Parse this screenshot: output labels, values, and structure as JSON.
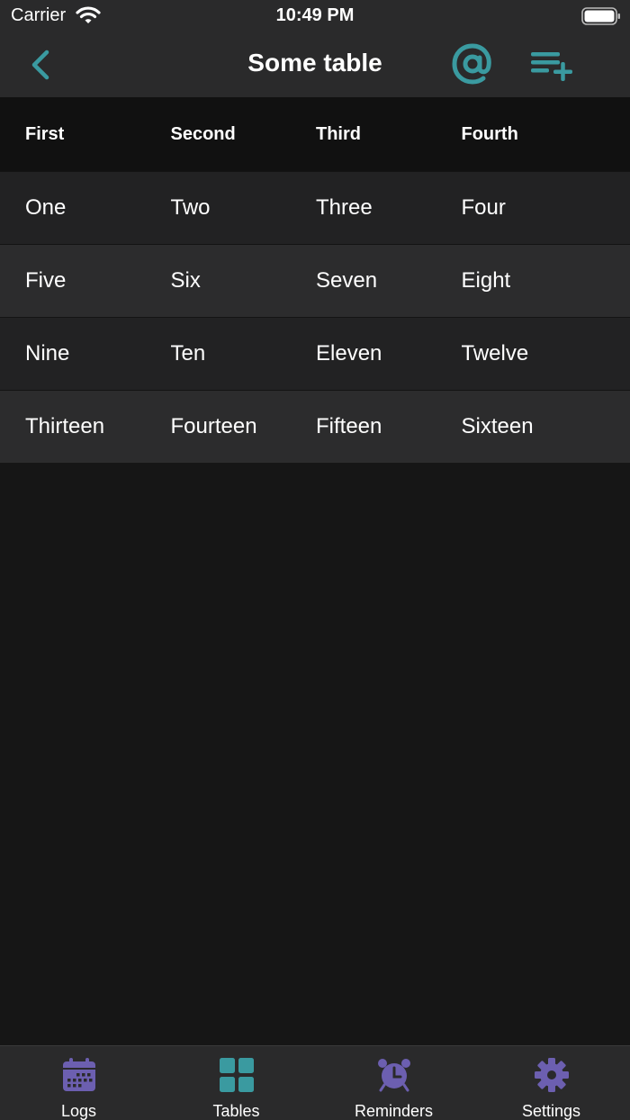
{
  "status_bar": {
    "carrier": "Carrier",
    "time": "10:49 PM"
  },
  "nav": {
    "title": "Some table",
    "accent_color": "#3a9aa0"
  },
  "table": {
    "headers": [
      "First",
      "Second",
      "Third",
      "Fourth"
    ],
    "rows": [
      [
        "One",
        "Two",
        "Three",
        "Four"
      ],
      [
        "Five",
        "Six",
        "Seven",
        "Eight"
      ],
      [
        "Nine",
        "Ten",
        "Eleven",
        "Twelve"
      ],
      [
        "Thirteen",
        "Fourteen",
        "Fifteen",
        "Sixteen"
      ]
    ]
  },
  "tabs": [
    {
      "label": "Logs",
      "icon": "calendar-icon",
      "color": "#6c5fb0"
    },
    {
      "label": "Tables",
      "icon": "grid-icon",
      "color": "#3a9aa0"
    },
    {
      "label": "Reminders",
      "icon": "alarm-clock-icon",
      "color": "#6c5fb0"
    },
    {
      "label": "Settings",
      "icon": "gear-icon",
      "color": "#6c5fb0"
    }
  ]
}
